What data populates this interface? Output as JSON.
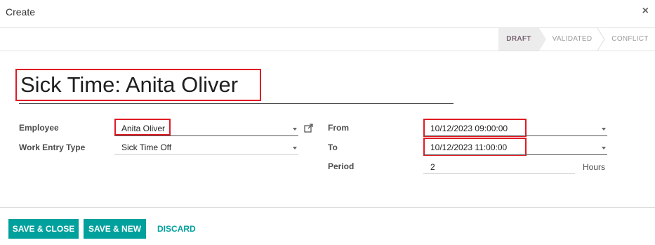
{
  "dialog": {
    "title": "Create",
    "close_label": "×"
  },
  "status": {
    "stages": [
      {
        "label": "DRAFT",
        "active": true
      },
      {
        "label": "VALIDATED",
        "active": false
      },
      {
        "label": "CONFLICT",
        "active": false
      }
    ]
  },
  "record": {
    "name": "Sick Time: Anita Oliver"
  },
  "fields": {
    "employee": {
      "label": "Employee",
      "value": "Anita Oliver"
    },
    "work_entry_type": {
      "label": "Work Entry Type",
      "value": "Sick Time Off"
    },
    "from": {
      "label": "From",
      "value": "10/12/2023 09:00:00"
    },
    "to": {
      "label": "To",
      "value": "10/12/2023 11:00:00"
    },
    "period": {
      "label": "Period",
      "value": "2",
      "unit": "Hours"
    }
  },
  "footer": {
    "save_close": "SAVE & CLOSE",
    "save_new": "SAVE & NEW",
    "discard": "DISCARD"
  },
  "colors": {
    "accent": "#00a09d",
    "highlight": "#e01b24",
    "active_stage_text": "#7a6473"
  }
}
